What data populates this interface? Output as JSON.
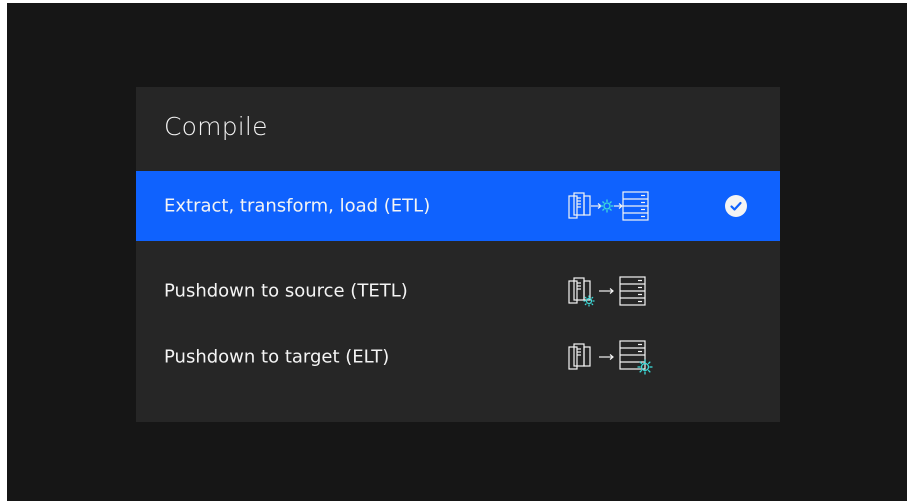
{
  "title": "Compile",
  "options": [
    {
      "label": "Extract, transform, load (ETL)",
      "selected": true,
      "icon": "source-gear-target-icon"
    },
    {
      "label": "Pushdown to source (TETL)",
      "selected": false,
      "icon": "source-with-gear-to-target-icon"
    },
    {
      "label": "Pushdown to target (ELT)",
      "selected": false,
      "icon": "source-to-target-with-gear-icon"
    }
  ],
  "colors": {
    "background": "#161616",
    "panel": "#262626",
    "selected": "#0f62fe",
    "text": "#f4f4f4",
    "accent": "#3ddbd9"
  }
}
